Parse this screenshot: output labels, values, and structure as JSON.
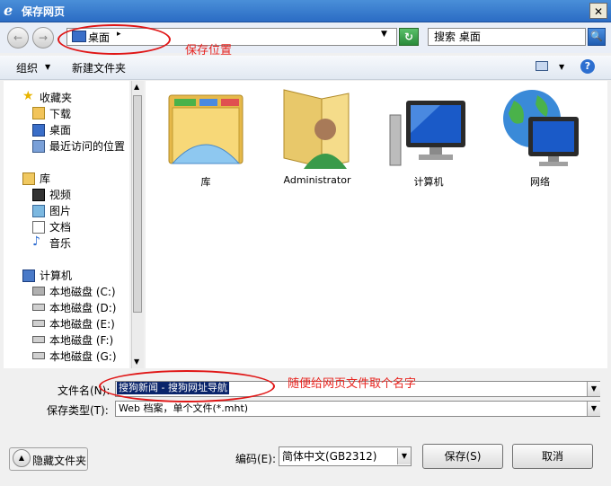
{
  "window": {
    "title": "保存网页",
    "close_glyph": "✕"
  },
  "nav": {
    "back_glyph": "←",
    "forward_glyph": "→",
    "location": "桌面",
    "location_arrow": "▸",
    "dropdown_glyph": "▼",
    "refresh_glyph": "↻",
    "search_placeholder": "搜索 桌面",
    "search_glyph": "🔍"
  },
  "toolbar": {
    "organize": "组织",
    "organize_arrow": "▼",
    "new_folder": "新建文件夹",
    "view_arrow": "▼",
    "help": "?"
  },
  "sidebar": {
    "favorites": {
      "label": "收藏夹",
      "items": [
        "下载",
        "桌面",
        "最近访问的位置"
      ]
    },
    "libraries": {
      "label": "库",
      "items": [
        "视频",
        "图片",
        "文档",
        "音乐"
      ]
    },
    "computer": {
      "label": "计算机",
      "items": [
        "本地磁盘 (C:)",
        "本地磁盘 (D:)",
        "本地磁盘 (E:)",
        "本地磁盘 (F:)",
        "本地磁盘 (G:)"
      ]
    }
  },
  "content": {
    "items": [
      "库",
      "Administrator",
      "计算机",
      "网络"
    ]
  },
  "form": {
    "filename_label": "文件名(N):",
    "filename_value": "搜狗新闻 - 搜狗网址导航",
    "filetype_label": "保存类型(T):",
    "filetype_value": "Web 档案，单个文件(*.mht)",
    "encoding_label": "编码(E):",
    "encoding_value": "简体中文(GB2312)",
    "dropdown_glyph": "▼"
  },
  "buttons": {
    "hide_folders": "隐藏文件夹",
    "save": "保存(S)",
    "cancel": "取消"
  },
  "annotations": {
    "save_location": "保存位置",
    "filename_hint": "随便给网页文件取个名字"
  },
  "colors": {
    "annotation_red": "#e01616",
    "selection_blue": "#0a246a"
  }
}
